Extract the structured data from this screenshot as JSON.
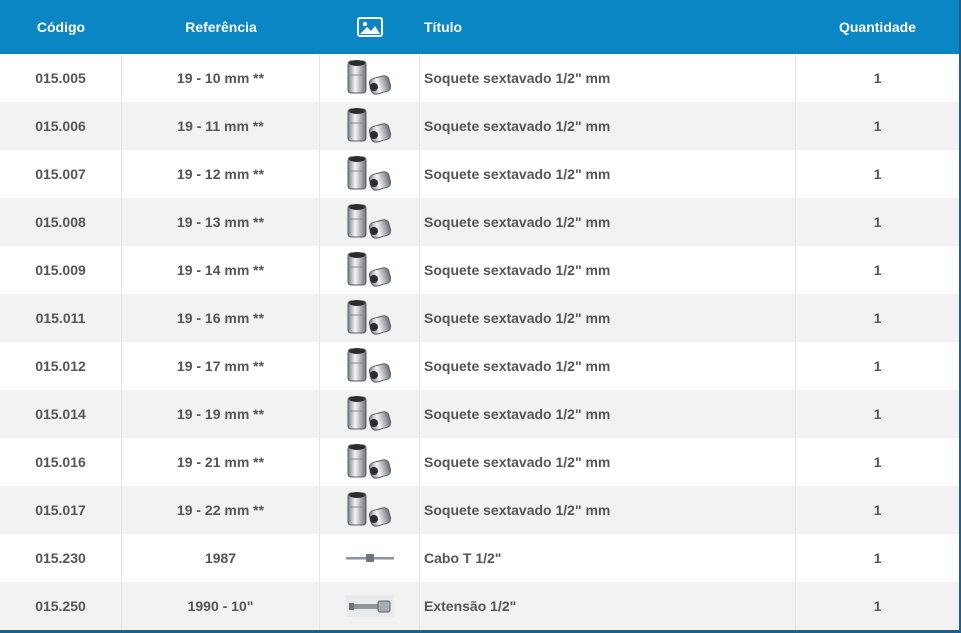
{
  "header": {
    "codigo": "Código",
    "referencia": "Referência",
    "imagem_icon": "image-icon",
    "titulo": "Título",
    "quantidade": "Quantidade"
  },
  "colors": {
    "header_bg": "#0b86c4",
    "header_text": "#ffffff",
    "row_alt_bg": "#f2f2f2",
    "text": "#555555",
    "frame": "#1f5f88"
  },
  "rows": [
    {
      "codigo": "015.005",
      "referencia": "19 - 10 mm **",
      "thumb": "socket-icon",
      "titulo": "Soquete sextavado 1/2\" mm",
      "quantidade": "1"
    },
    {
      "codigo": "015.006",
      "referencia": "19 - 11 mm **",
      "thumb": "socket-icon",
      "titulo": "Soquete sextavado 1/2\" mm",
      "quantidade": "1"
    },
    {
      "codigo": "015.007",
      "referencia": "19 - 12 mm **",
      "thumb": "socket-icon",
      "titulo": "Soquete sextavado 1/2\" mm",
      "quantidade": "1"
    },
    {
      "codigo": "015.008",
      "referencia": "19 - 13 mm **",
      "thumb": "socket-icon",
      "titulo": "Soquete sextavado 1/2\" mm",
      "quantidade": "1"
    },
    {
      "codigo": "015.009",
      "referencia": "19 - 14 mm **",
      "thumb": "socket-icon",
      "titulo": "Soquete sextavado 1/2\" mm",
      "quantidade": "1"
    },
    {
      "codigo": "015.011",
      "referencia": "19 - 16 mm **",
      "thumb": "socket-icon",
      "titulo": "Soquete sextavado 1/2\" mm",
      "quantidade": "1"
    },
    {
      "codigo": "015.012",
      "referencia": "19 - 17 mm **",
      "thumb": "socket-icon",
      "titulo": "Soquete sextavado 1/2\" mm",
      "quantidade": "1"
    },
    {
      "codigo": "015.014",
      "referencia": "19 - 19 mm **",
      "thumb": "socket-icon",
      "titulo": "Soquete sextavado 1/2\" mm",
      "quantidade": "1"
    },
    {
      "codigo": "015.016",
      "referencia": "19 - 21 mm **",
      "thumb": "socket-icon",
      "titulo": "Soquete sextavado 1/2\" mm",
      "quantidade": "1"
    },
    {
      "codigo": "015.017",
      "referencia": "19 - 22 mm **",
      "thumb": "socket-icon",
      "titulo": "Soquete sextavado 1/2\" mm",
      "quantidade": "1"
    },
    {
      "codigo": "015.230",
      "referencia": "1987",
      "thumb": "t-handle-icon",
      "titulo": "Cabo T 1/2\"",
      "quantidade": "1"
    },
    {
      "codigo": "015.250",
      "referencia": "1990 - 10\"",
      "thumb": "extension-bar-icon",
      "titulo": "Extensão 1/2\"",
      "quantidade": "1"
    }
  ]
}
